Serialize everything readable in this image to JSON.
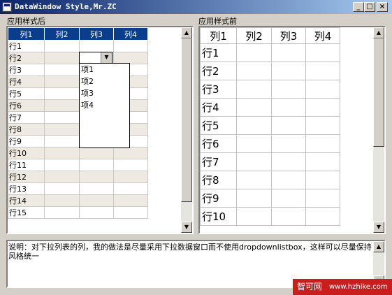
{
  "window": {
    "title": "DataWindow Style,Mr.ZC",
    "minimize_glyph": "_",
    "maximize_glyph": "□",
    "close_glyph": "×"
  },
  "left_panel": {
    "label": "应用样式后",
    "columns": [
      "列1",
      "列2",
      "列3",
      "列4"
    ],
    "rows": [
      "行1",
      "行2",
      "行3",
      "行4",
      "行5",
      "行6",
      "行7",
      "行8",
      "行9",
      "行10",
      "行11",
      "行12",
      "行13",
      "行14",
      "行15"
    ],
    "header_color": "#0a3d8c",
    "alt_row_color": "#eeeae2",
    "dropdown": {
      "value": "",
      "arrow_glyph": "▼",
      "options": [
        "项1",
        "项2",
        "项3",
        "项4"
      ]
    }
  },
  "right_panel": {
    "label": "应用样式前",
    "columns": [
      "列1",
      "列2",
      "列3",
      "列4"
    ],
    "rows": [
      "行1",
      "行2",
      "行3",
      "行4",
      "行5",
      "行6",
      "行7",
      "行8",
      "行9",
      "行10"
    ]
  },
  "scroll_glyphs": {
    "up": "▲",
    "down": "▼"
  },
  "description": "说明：对下拉列表的列，我的做法是尽量采用下拉数据窗口而不使用dropdownlistbox，这样可以尽量保持风格统一",
  "watermark": {
    "site": "智可网",
    "url": "www.hzhike.com"
  }
}
